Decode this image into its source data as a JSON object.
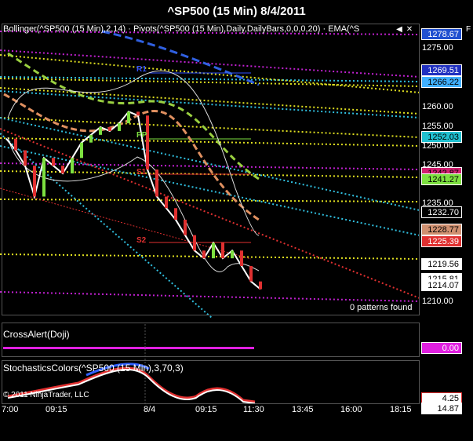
{
  "window": {
    "title": "^SP500 (15 Min)  8/4/2011"
  },
  "price_panel": {
    "indicator_label": "Bollinger(^SP500 (15 Min),2,14) · Pivots(^SP500 (15 Min),Daily,DailyBars,0,0,0,20) · EMA(^S",
    "patterns_text": "0 patterns found",
    "pivot_labels": {
      "r1": "R1",
      "pp": "PP",
      "s1": "S1",
      "s2": "S2"
    },
    "y_axis": [
      "1275.00",
      "1260.00",
      "1255.00",
      "1250.00",
      "1245.00",
      "1235.00",
      "1210.00"
    ],
    "price_tags": [
      {
        "value": "1278.67",
        "color": "#2050d0",
        "text_color": "#ffffff"
      },
      {
        "value": "1269.51",
        "color": "#2030c0",
        "text_color": "#ffffff"
      },
      {
        "value": "1266.22",
        "color": "#40b0ff",
        "text_color": "#000000"
      },
      {
        "value": "1252.03",
        "color": "#20c0d0",
        "text_color": "#000000"
      },
      {
        "value": "1242.87",
        "color": "#d02070",
        "text_color": "#000000"
      },
      {
        "value": "1241.27",
        "color": "#7de040",
        "text_color": "#000000"
      },
      {
        "value": "1232.70",
        "color": "#000000",
        "text_color": "#ffffff"
      },
      {
        "value": "1228.77",
        "color": "#d09070",
        "text_color": "#000000"
      },
      {
        "value": "1225.39",
        "color": "#e03030",
        "text_color": "#ffffff"
      },
      {
        "value": "1219.56",
        "color": "#ffffff",
        "text_color": "#000000"
      },
      {
        "value": "1215.81",
        "color": "#ffffff",
        "text_color": "#000000"
      },
      {
        "value": "1214.07",
        "color": "#ffffff",
        "text_color": "#000000"
      }
    ]
  },
  "cross_panel": {
    "label": "CrossAlert(Doji)",
    "value": "0.00",
    "value_color": "#e020e0"
  },
  "stoch_panel": {
    "label": "StochasticsColors(^SP500 (15 Min),3,70,3)",
    "values": [
      "4.25",
      "14.87"
    ],
    "copyright": "© 2011 NinjaTrader, LLC"
  },
  "x_axis": [
    "7:00",
    "09:15",
    "8/4",
    "09:15",
    "11:30",
    "13:45",
    "16:00",
    "18:15"
  ],
  "buttons": {
    "left": "◀",
    "close": "✕",
    "f": "F"
  },
  "colors": {
    "background": "#000000",
    "up_bar": "#7de040",
    "down_bar": "#e03030",
    "pivot_yellow": "#e0e020",
    "pivot_magenta": "#c020d0",
    "cyan": "#30c0e0",
    "ema": "#e09060"
  },
  "chart_data": {
    "type": "line",
    "title": "^SP500 (15 Min)  8/4/2011",
    "x": [
      "7:00",
      "09:15",
      "8/4",
      "09:15",
      "11:30",
      "13:45",
      "16:00",
      "18:15"
    ],
    "ylim": [
      1208,
      1280
    ],
    "series": [
      {
        "values": [
          1253,
          1250,
          1246,
          1238,
          1248,
          1246,
          1244,
          1248,
          1252,
          1254,
          1256,
          1255,
          1257,
          1260,
          1259,
          1245,
          1238,
          1235,
          1232,
          1228,
          1224,
          1222,
          1226,
          1222,
          1224,
          1220,
          1216,
          1214
        ]
      }
    ]
  }
}
